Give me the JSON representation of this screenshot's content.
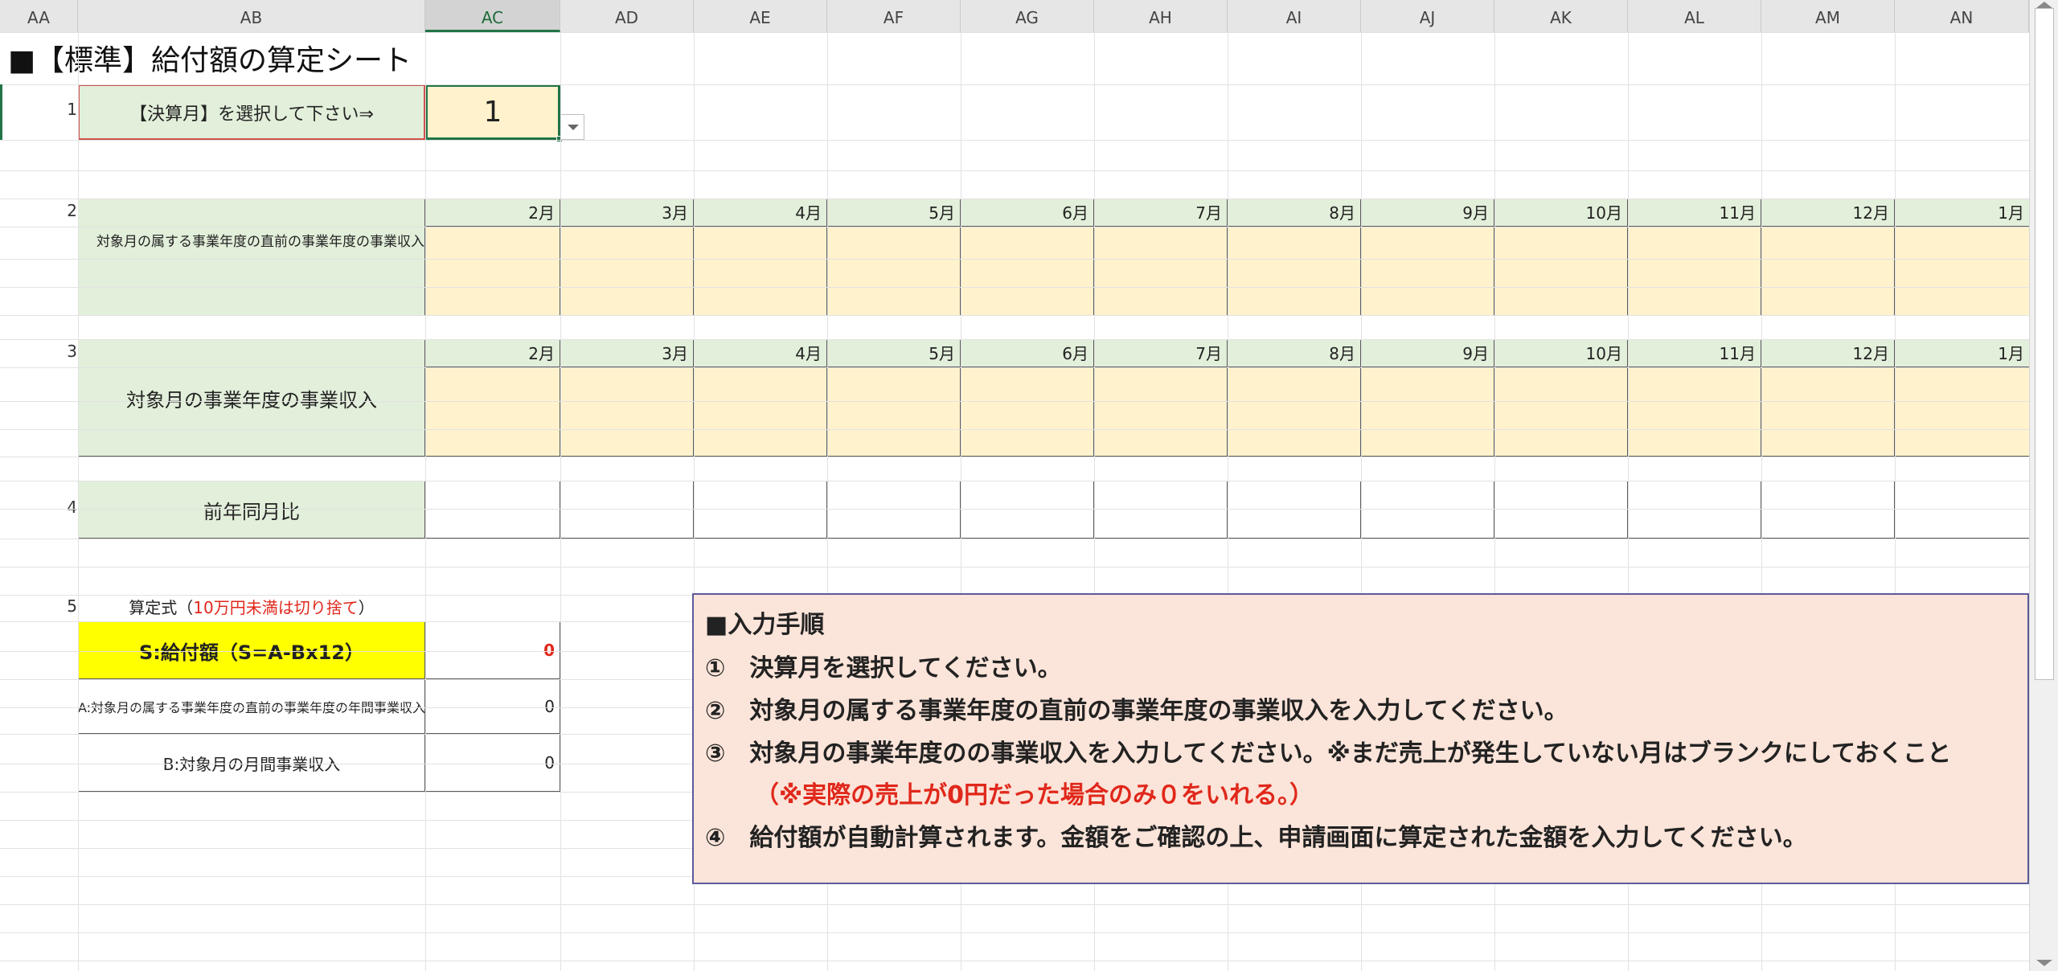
{
  "columns": [
    "AA",
    "AB",
    "AC",
    "AD",
    "AE",
    "AF",
    "AG",
    "AH",
    "AI",
    "AJ",
    "AK",
    "AL",
    "AM",
    "AN"
  ],
  "selected_column": "AC",
  "sheet_title": "■【標準】給付額の算定シート",
  "row_numbers": [
    "1",
    "2",
    "3",
    "4",
    "5"
  ],
  "settlement": {
    "label": "【決算月】を選択して下さい⇒",
    "value": "1"
  },
  "prev_year_income": {
    "label": "対象月の属する事業年度の直前の事業年度の事業収入",
    "months": [
      "2月",
      "3月",
      "4月",
      "5月",
      "6月",
      "7月",
      "8月",
      "9月",
      "10月",
      "11月",
      "12月",
      "1月"
    ]
  },
  "current_year_income": {
    "label": "対象月の事業年度の事業収入",
    "months": [
      "2月",
      "3月",
      "4月",
      "5月",
      "6月",
      "7月",
      "8月",
      "9月",
      "10月",
      "11月",
      "12月",
      "1月"
    ]
  },
  "yoy": {
    "label": "前年同月比"
  },
  "formula": {
    "title_prefix": "算定式（",
    "title_red": "10万円未満は切り捨て",
    "title_suffix": "）",
    "s_label": "S:給付額（S=A-Bx12）",
    "s_value": "0",
    "a_label": "A:対象月の属する事業年度の直前の事業年度の年間事業収入",
    "a_value": "0",
    "b_label": "B:対象月の月間事業収入",
    "b_value": "0"
  },
  "instructions": {
    "title": "■入力手順",
    "step1": "①　決算月を選択してください。",
    "step2": "②　対象月の属する事業年度の直前の事業年度の事業収入を入力してください。",
    "step3": "③　対象月の事業年度のの事業収入を入力してください。※まだ売上が発生していない月はブランクにしておくこと",
    "step3_note": "（※実際の売上が0円だった場合のみ０をいれる。）",
    "step4": "④　給付額が自動計算されます。金額をご確認の上、申請画面に算定された金額を入力してください。"
  },
  "colors": {
    "header_green": "#e2efda",
    "input_cream": "#fff2cc",
    "highlight_yellow": "#ffff00",
    "instruction_bg": "#fbe4d9",
    "accent_red": "#e0281b",
    "selection_green": "#217346"
  }
}
